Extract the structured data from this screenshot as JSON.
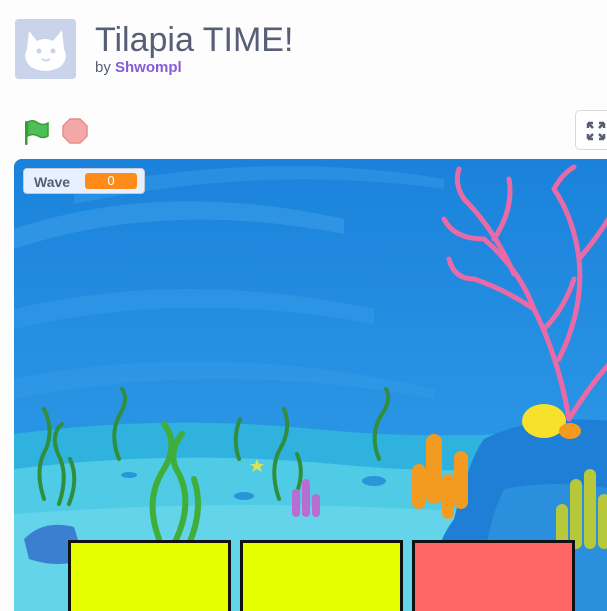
{
  "project": {
    "title": "Tilapia TIME!",
    "by": "by",
    "author": "Shwompl"
  },
  "controls": {
    "green_flag_icon": "green-flag-icon",
    "stop_icon": "stop-sign-icon",
    "fullscreen_icon": "fullscreen-icon"
  },
  "stage": {
    "monitor": {
      "label": "Wave",
      "value": "0",
      "value_color": "#ff8c1a"
    },
    "tiles": [
      {
        "color": "#e5ff00"
      },
      {
        "color": "#e5ff00"
      },
      {
        "color": "#ff6666"
      }
    ]
  },
  "colors": {
    "title_text": "#575e75",
    "author_link": "#855cd6",
    "water_deep": "#1f8be0",
    "seafloor": "#4fcbe6",
    "coral_pink": "#ea6aa7"
  }
}
